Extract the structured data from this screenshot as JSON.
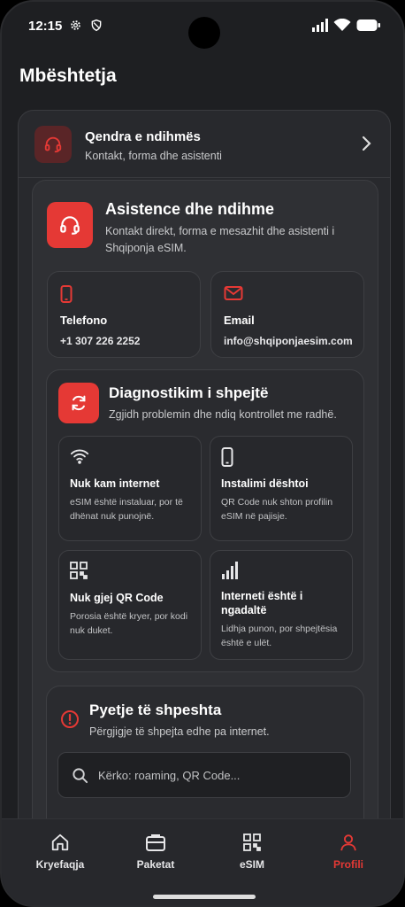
{
  "status_bar": {
    "time": "12:15"
  },
  "page": {
    "title": "Mbështetja"
  },
  "help_center": {
    "title": "Qendra e ndihmës",
    "subtitle": "Kontakt, forma dhe asistenti"
  },
  "assistance": {
    "title": "Asistence dhe ndihme",
    "description": "Kontakt direkt, forma e mesazhit dhe asistenti i Shqiponja eSIM."
  },
  "contacts": [
    {
      "label": "Telefono",
      "value": "+1 307 226 2252",
      "icon": "phone-icon"
    },
    {
      "label": "Email",
      "value": "info@shqiponjaesim.com",
      "icon": "mail-icon"
    }
  ],
  "diagnostics": {
    "title": "Diagnostikim i shpejtë",
    "subtitle": "Zgjidh problemin dhe ndiq kontrollet me radhë.",
    "tiles": [
      {
        "title": "Nuk kam internet",
        "desc": "eSIM është instaluar, por të dhënat nuk punojnë.",
        "icon": "wifi-icon"
      },
      {
        "title": "Instalimi dështoi",
        "desc": "QR Code nuk shton profilin eSIM në pajisje.",
        "icon": "smartphone-icon"
      },
      {
        "title": "Nuk gjej QR Code",
        "desc": "Porosia është kryer, por kodi nuk duket.",
        "icon": "qr-code-icon"
      },
      {
        "title": "Interneti është i ngadaltë",
        "desc": "Lidhja punon, por shpejtësia është e ulët.",
        "icon": "signal-bars-icon"
      }
    ]
  },
  "faq": {
    "title": "Pyetje të shpeshta",
    "subtitle": "Përgjigje të shpejta edhe pa internet.",
    "search_placeholder": "Kërko: roaming, QR Code..."
  },
  "nav": {
    "items": [
      {
        "label": "Kryefaqja",
        "icon": "home-icon",
        "active": false
      },
      {
        "label": "Paketat",
        "icon": "briefcase-icon",
        "active": false
      },
      {
        "label": "eSIM",
        "icon": "qr-code-icon",
        "active": false
      },
      {
        "label": "Profili",
        "icon": "user-icon",
        "active": true
      }
    ]
  },
  "colors": {
    "accent": "#e53935",
    "background": "#1e1f22",
    "card": "#2a2b2f"
  }
}
